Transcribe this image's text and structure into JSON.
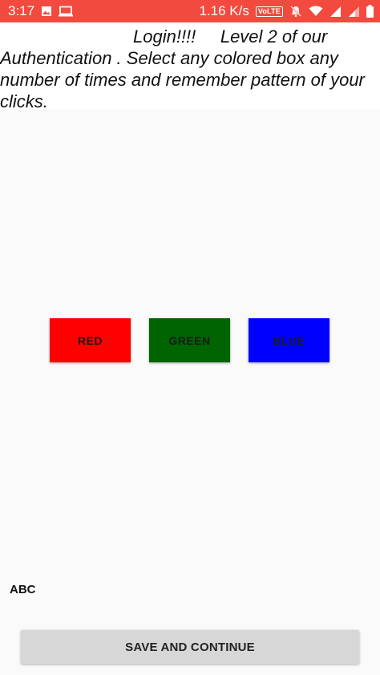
{
  "status_bar": {
    "time": "3:17",
    "network_speed": "1.16 K/s",
    "volte_label": "VoLTE",
    "icons": [
      "image-icon",
      "monitor-icon",
      "volte-icon",
      "mute-icon",
      "wifi-icon",
      "signal-icon",
      "signal-icon-2",
      "battery-icon"
    ],
    "background_color": "#f24a3f"
  },
  "header": {
    "line1": "Login!!!!     Level 2 of our",
    "line2": "Authentication . Select any colored box any",
    "line3": "number of times and remember pattern of your",
    "line4": "clicks."
  },
  "color_buttons": [
    {
      "label": "RED",
      "color": "#ff0000"
    },
    {
      "label": "GREEN",
      "color": "#006400"
    },
    {
      "label": "BLUE",
      "color": "#0000ff"
    }
  ],
  "abc_label": "ABC",
  "save_button_label": "SAVE AND CONTINUE"
}
